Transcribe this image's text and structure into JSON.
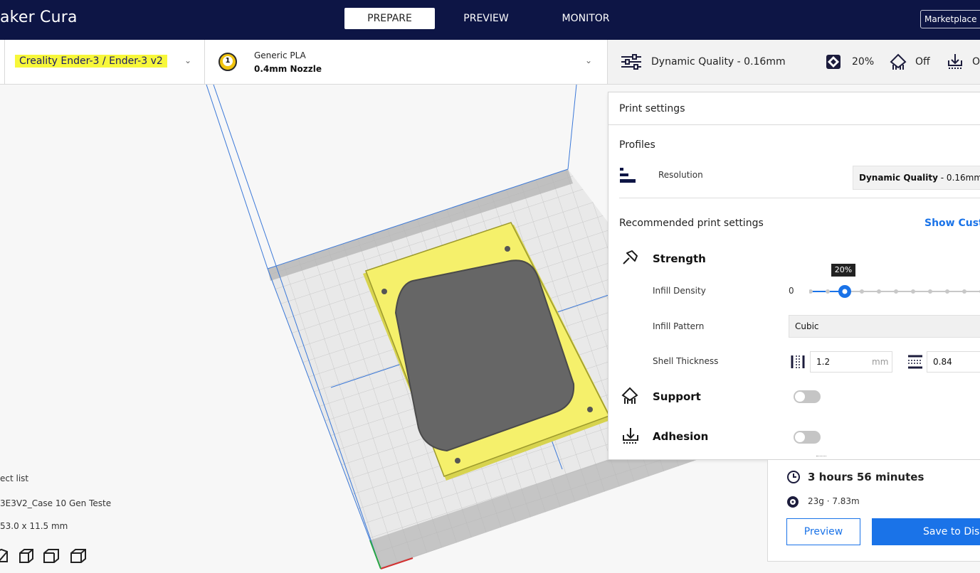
{
  "app": {
    "title": "aker Cura"
  },
  "nav": {
    "tabs": [
      {
        "label": "PREPARE",
        "active": true
      },
      {
        "label": "PREVIEW",
        "active": false
      },
      {
        "label": "MONITOR",
        "active": false
      }
    ],
    "marketplace_label": "Marketplace"
  },
  "printer": {
    "name": "Creality Ender-3 / Ender-3 v2",
    "highlight_color": "#f7f73a"
  },
  "material": {
    "extruder_number": "1",
    "name": "Generic PLA",
    "nozzle": "0.4mm Nozzle"
  },
  "settings_summary": {
    "profile": "Dynamic Quality - 0.16mm",
    "infill": "20%",
    "support": "Off",
    "adhesion": "O"
  },
  "print_settings": {
    "title": "Print settings",
    "profiles_label": "Profiles",
    "resolution_label": "Resolution",
    "resolution_value_bold": "Dynamic Quality",
    "resolution_value_rest": " - 0.16mm",
    "recommended_label": "Recommended print settings",
    "show_custom_label": "Show Cust",
    "strength_label": "Strength",
    "infill_density_label": "Infill Density",
    "infill_density_min": "0",
    "infill_density_tooltip": "20%",
    "infill_density_fraction": 0.2,
    "infill_pattern_label": "Infill Pattern",
    "infill_pattern_value": "Cubic",
    "shell_thickness_label": "Shell Thickness",
    "wall_thickness": "1.2",
    "wall_unit": "mm",
    "top_bottom_thickness": "0.84",
    "support_label": "Support",
    "adhesion_label": "Adhesion"
  },
  "estimate": {
    "time": "3 hours 56 minutes",
    "material": "23g · 7.83m",
    "preview_button": "Preview",
    "save_button": "Save to Dis"
  },
  "object_list": {
    "header": "ect list",
    "object_name": "3E3V2_Case 10 Gen Teste",
    "dimensions": "53.0 x 11.5 mm"
  },
  "colors": {
    "topbar": "#0d1545",
    "accent_blue": "#1a73e8",
    "model_yellow": "#f5f06b",
    "build_volume_line": "#3a78d8"
  }
}
